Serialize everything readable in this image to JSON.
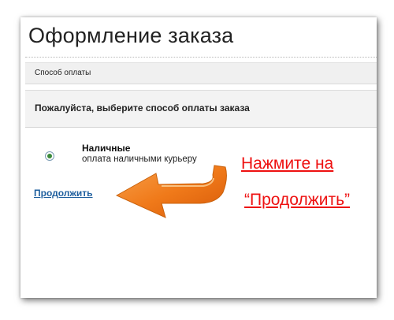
{
  "checkout": {
    "title": "Оформление заказа",
    "section_label": "Способ оплаты",
    "prompt": "Пожалуйста, выберите способ оплаты заказа",
    "payment_option": {
      "title": "Наличные",
      "description": "оплата наличными курьеру",
      "selected": true
    },
    "continue_label": "Продолжить"
  },
  "annotation": {
    "line1": "Нажмите на",
    "line2": "“Продолжить”",
    "color": "#ee1111",
    "arrow_color": "#f07a1a",
    "arrow_icon": "left-arrow-icon"
  }
}
